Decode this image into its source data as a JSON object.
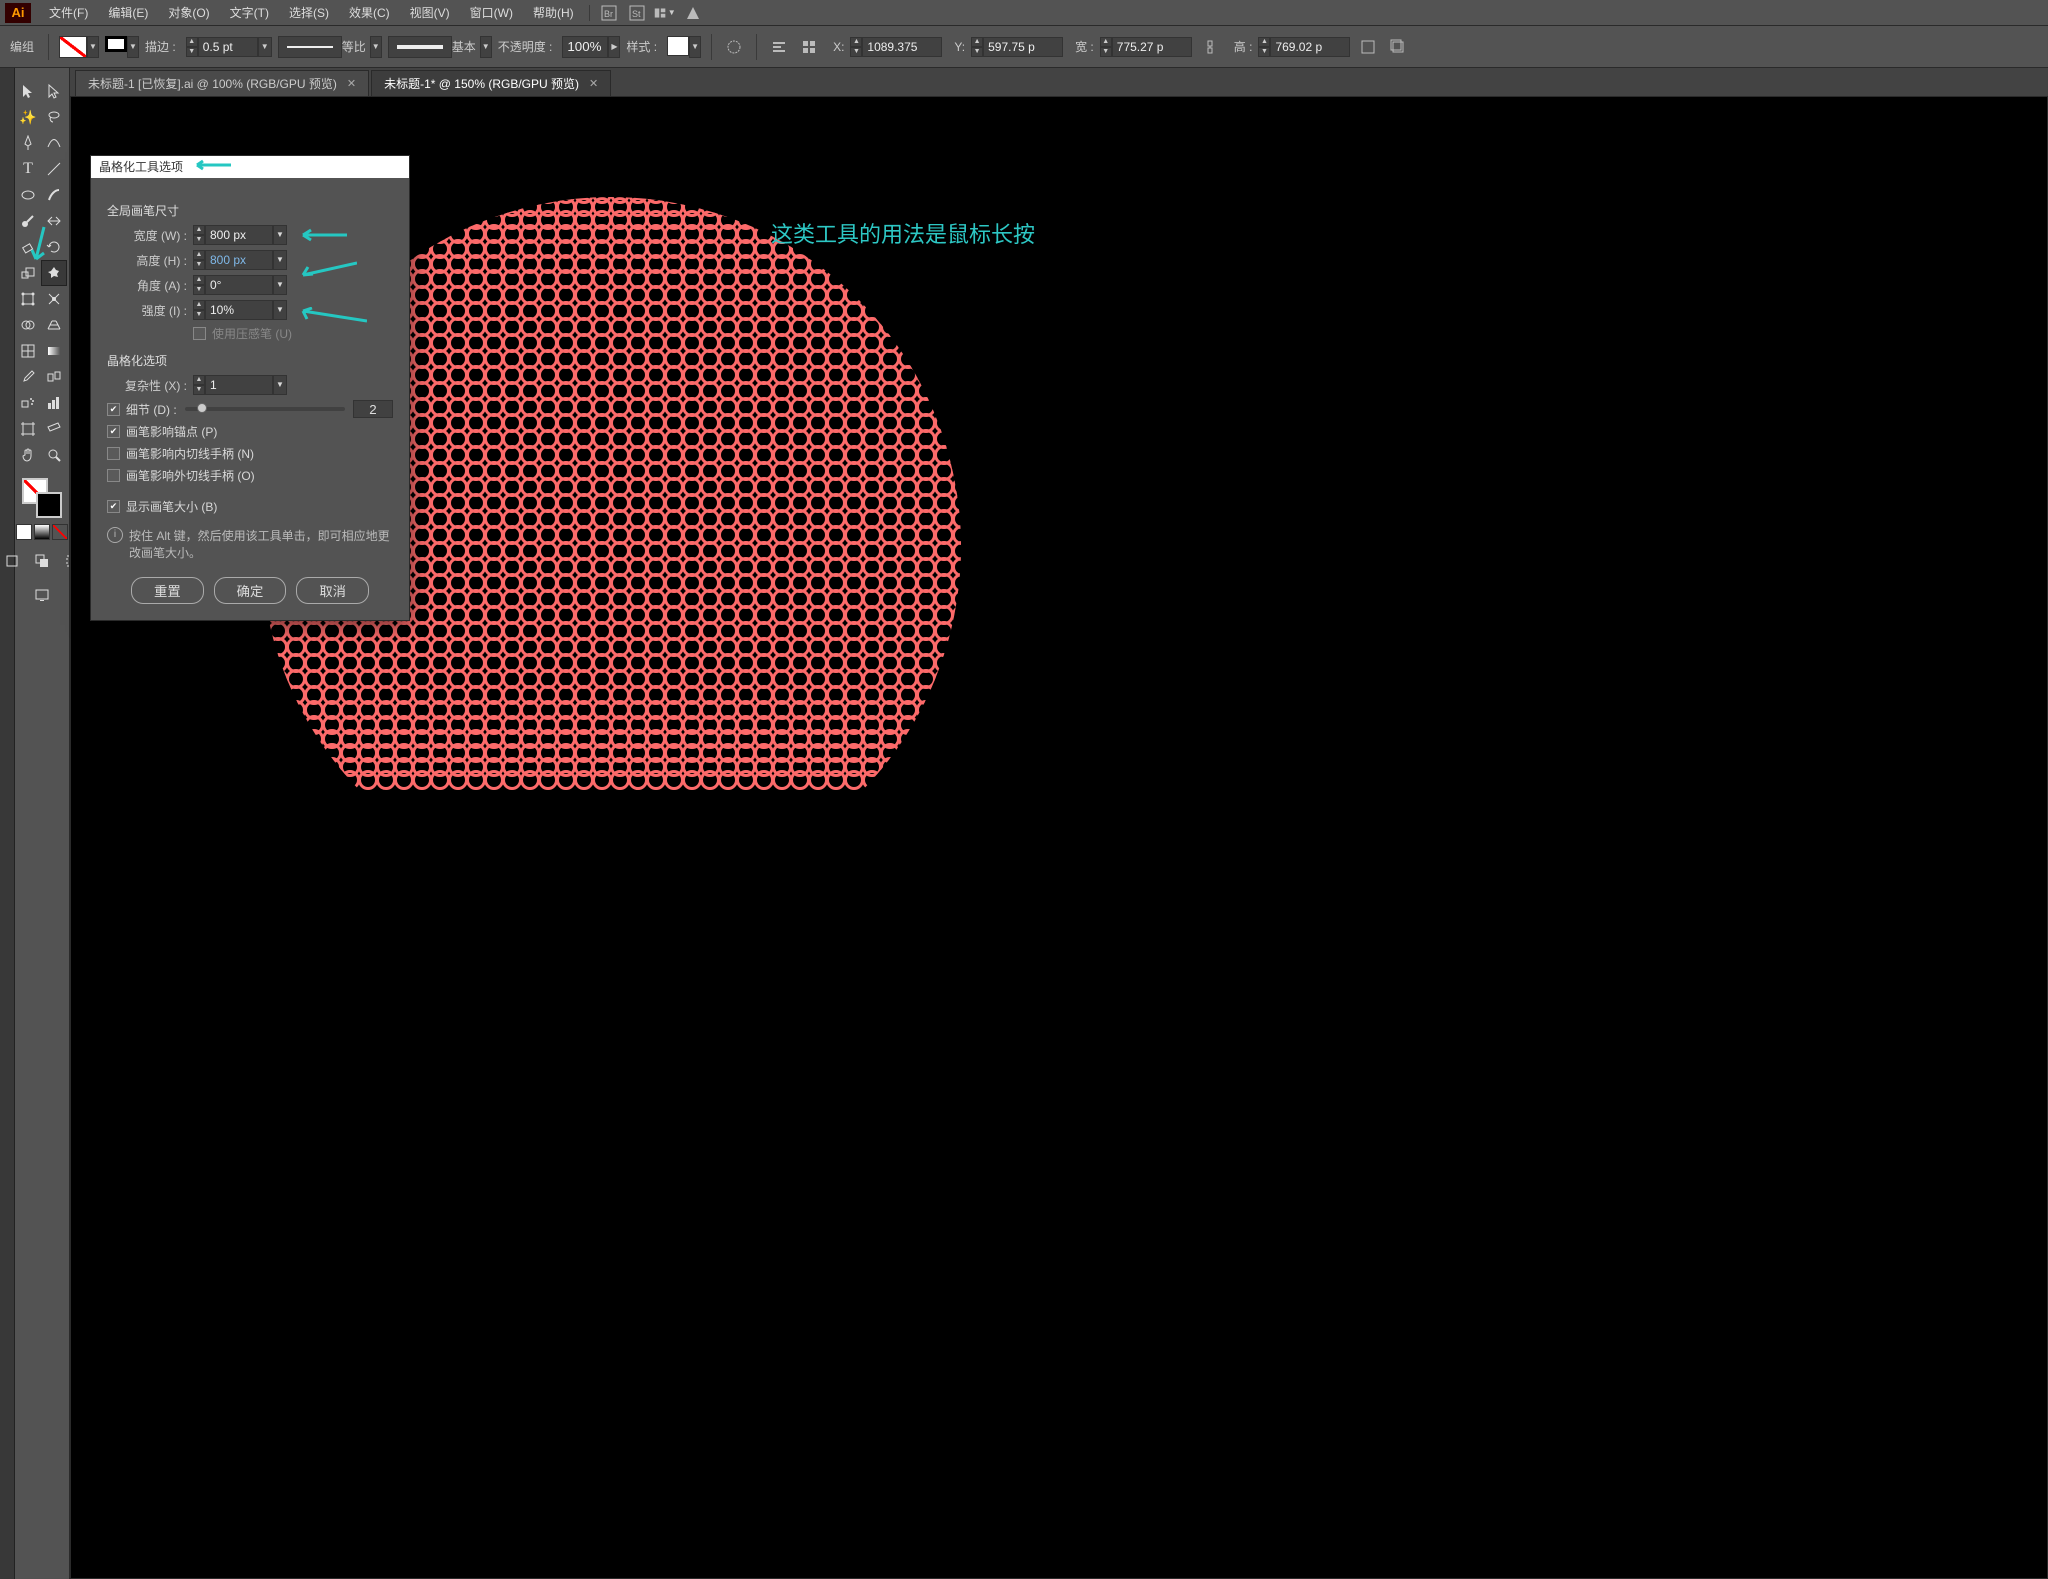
{
  "menubar": {
    "logo": "Ai",
    "items": [
      "文件(F)",
      "编辑(E)",
      "对象(O)",
      "文字(T)",
      "选择(S)",
      "效果(C)",
      "视图(V)",
      "窗口(W)",
      "帮助(H)"
    ]
  },
  "controlbar": {
    "mode": "编组",
    "stroke_label": "描边 :",
    "stroke_weight": "0.5 pt",
    "profile1_label": "等比",
    "profile2_label": "基本",
    "opacity_label": "不透明度 :",
    "opacity_value": "100%",
    "style_label": "样式 :",
    "x_label": "X:",
    "x_value": "1089.375",
    "y_label": "Y:",
    "y_value": "597.75 p",
    "w_label": "宽 :",
    "w_value": "775.27 p",
    "h_label": "高 :",
    "h_value": "769.02 p"
  },
  "doctabs": [
    {
      "label": "未标题-1  [已恢复].ai @ 100% (RGB/GPU 预览)",
      "active": false
    },
    {
      "label": "未标题-1* @ 150% (RGB/GPU 预览)",
      "active": true
    }
  ],
  "annotation": "这类工具的用法是鼠标长按",
  "dialog": {
    "title": "晶格化工具选项",
    "section_global": "全局画笔尺寸",
    "width_label": "宽度 (W) :",
    "width_value": "800 px",
    "height_label": "高度 (H) :",
    "height_value": "800 px",
    "angle_label": "角度 (A) :",
    "angle_value": "0°",
    "intensity_label": "强度 (I) :",
    "intensity_value": "10%",
    "pressure_label": "使用压感笔 (U)",
    "section_opts": "晶格化选项",
    "complex_label": "复杂性 (X) :",
    "complex_value": "1",
    "detail_label": "细节 (D) :",
    "detail_value": "2",
    "anchor_label": "画笔影响锚点 (P)",
    "intan_label": "画笔影响内切线手柄 (N)",
    "outtan_label": "画笔影响外切线手柄 (O)",
    "showsize_label": "显示画笔大小 (B)",
    "info_text": "按住 Alt 键，然后使用该工具单击，即可相应地更改画笔大小。",
    "reset_btn": "重置",
    "ok_btn": "确定",
    "cancel_btn": "取消"
  },
  "tool_names": {
    "selection": "selection-tool",
    "direct": "direct-selection-tool",
    "wand": "magic-wand-tool",
    "lasso": "lasso-tool",
    "pen": "pen-tool",
    "curvature": "curvature-tool",
    "type": "type-tool",
    "line": "line-tool",
    "ellipse": "ellipse-tool",
    "brush": "brush-tool",
    "blob": "blob-brush-tool",
    "shaper": "shaper-tool",
    "eraser": "eraser-tool",
    "rotate": "rotate-tool",
    "scale": "scale-tool",
    "width": "width-tool",
    "crystallize": "crystallize-tool",
    "freetrans": "free-transform-tool",
    "puppet": "puppet-warp-tool",
    "shapebuild": "shape-builder-tool",
    "perspective": "perspective-grid-tool",
    "mesh": "mesh-tool",
    "gradient": "gradient-tool",
    "eyedrop": "eyedropper-tool",
    "measure": "measure-tool",
    "blend": "blend-tool",
    "symbol": "symbol-sprayer-tool",
    "graph": "column-graph-tool",
    "artboard": "artboard-tool",
    "slice": "slice-tool",
    "hand": "hand-tool",
    "zoom": "zoom-tool"
  }
}
